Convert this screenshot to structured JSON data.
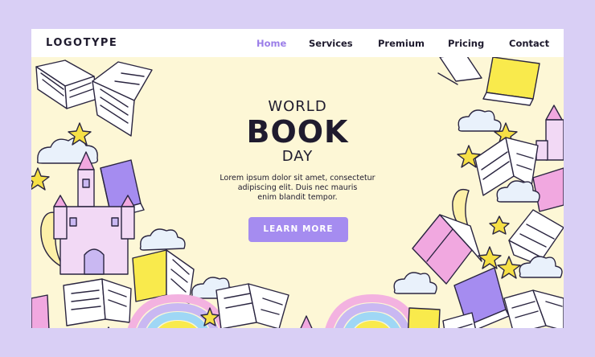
{
  "header": {
    "logo": "LOGOTYPE",
    "nav": [
      {
        "label": "Home",
        "active": true
      },
      {
        "label": "Services",
        "active": false
      },
      {
        "label": "Premium",
        "active": false
      },
      {
        "label": "Pricing",
        "active": false
      },
      {
        "label": "Contact",
        "active": false
      }
    ]
  },
  "hero": {
    "line1": "WORLD",
    "line2": "BOOK",
    "line3": "DAY",
    "body_line1": "Lorem ipsum dolor sit amet, consectetur",
    "body_line2": "adipiscing elit. Duis nec mauris",
    "body_line3": "enim blandit tempor.",
    "cta": "LEARN MORE"
  },
  "colors": {
    "page_background": "#d9cff5",
    "hero_background": "#fdf7d6",
    "accent": "#a58cf0",
    "nav_active": "#9b7ee8",
    "text": "#1f1b2e"
  },
  "illustrations": [
    "open-book-icon",
    "closed-book-icon",
    "castle-icon",
    "rainbow-icon",
    "cloud-icon",
    "star-icon",
    "crescent-moon-icon"
  ]
}
